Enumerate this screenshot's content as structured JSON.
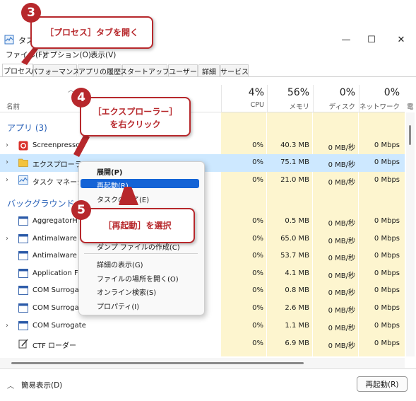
{
  "window": {
    "title": "タス",
    "controls": {
      "minimize": "—",
      "maximize": "☐",
      "close": "✕"
    }
  },
  "menu": [
    "ファイル(F)",
    "オプション(O)",
    "表示(V)"
  ],
  "tabs": [
    "プロセス",
    "パフォーマンス",
    "アプリの履歴",
    "スタートアップ",
    "ユーザー",
    "詳細",
    "サービス"
  ],
  "columns": {
    "name": "名前",
    "cpu": {
      "pct": "4%",
      "label": "CPU"
    },
    "memory": {
      "pct": "56%",
      "label": "メモリ"
    },
    "disk": {
      "pct": "0%",
      "label": "ディスク"
    },
    "network": {
      "pct": "0%",
      "label": "ネットワーク"
    },
    "power": {
      "label": "電"
    }
  },
  "sections": {
    "apps": "アプリ (3)",
    "background": "バックグラウンド ア"
  },
  "rows": [
    {
      "name": "Screenpresso",
      "cpu": "0%",
      "mem": "40.3 MB",
      "disk": "0 MB/秒",
      "net": "0 Mbps"
    },
    {
      "name": "エクスプローラー (2)",
      "cpu": "0%",
      "mem": "75.1 MB",
      "disk": "0 MB/秒",
      "net": "0 Mbps"
    },
    {
      "name": "タスク マネージ",
      "cpu": "0%",
      "mem": "21.0 MB",
      "disk": "0 MB/秒",
      "net": "0 Mbps"
    },
    {
      "name": "AggregatorH",
      "cpu": "0%",
      "mem": "0.5 MB",
      "disk": "0 MB/秒",
      "net": "0 Mbps"
    },
    {
      "name": "Antimalware",
      "cpu": "0%",
      "mem": "65.0 MB",
      "disk": "0 MB/秒",
      "net": "0 Mbps"
    },
    {
      "name": "Antimalware",
      "cpu": "0%",
      "mem": "53.7 MB",
      "disk": "0 MB/秒",
      "net": "0 Mbps"
    },
    {
      "name": "Application F",
      "cpu": "0%",
      "mem": "4.1 MB",
      "disk": "0 MB/秒",
      "net": "0 Mbps"
    },
    {
      "name": "COM Surroga",
      "cpu": "0%",
      "mem": "0.8 MB",
      "disk": "0 MB/秒",
      "net": "0 Mbps"
    },
    {
      "name": "COM Surroga",
      "cpu": "0%",
      "mem": "2.6 MB",
      "disk": "0 MB/秒",
      "net": "0 Mbps"
    },
    {
      "name": "COM Surrogate",
      "cpu": "0%",
      "mem": "1.1 MB",
      "disk": "0 MB/秒",
      "net": "0 Mbps"
    },
    {
      "name": "CTF ローダー",
      "cpu": "0%",
      "mem": "6.9 MB",
      "disk": "0 MB/秒",
      "net": "0 Mbps"
    }
  ],
  "context_menu": [
    "展開(P)",
    "再起動(R)",
    "タスクの終了(E)",
    "ダンプ ファイルの作成(C)",
    "詳細の表示(G)",
    "ファイルの場所を開く(O)",
    "オンライン検索(S)",
    "プロパティ(I)"
  ],
  "footer": {
    "compact": "簡易表示(D)",
    "end_task": "再起動(R)"
  },
  "callouts": {
    "c3": {
      "num": "3",
      "text": "［プロセス］タブを開く"
    },
    "c4": {
      "num": "4",
      "line1": "［エクスプローラー］",
      "line2": "を右クリック"
    },
    "c5": {
      "num": "5",
      "text": "［再起動］を選択"
    }
  },
  "colors": {
    "accent": "#b7282c",
    "selection": "#cde8ff",
    "menu_highlight": "#1463d6",
    "heat": "#fdf5cf"
  }
}
